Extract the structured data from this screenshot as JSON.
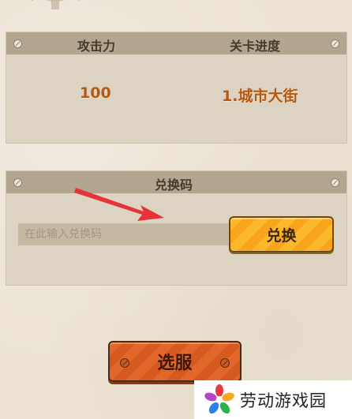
{
  "stats": {
    "attack_label": "攻击力",
    "progress_label": "关卡进度",
    "attack_value": "100",
    "progress_value": "1.城市大街"
  },
  "redeem": {
    "title": "兑换码",
    "placeholder": "在此输入兑换码",
    "button_label": "兑换"
  },
  "server": {
    "button_label": "选服"
  },
  "watermark": {
    "text": "劳动游戏园"
  },
  "colors": {
    "accent_orange": "#b45a16",
    "redeem_button": "#fbb82c",
    "server_button": "#e2672a",
    "arrow": "#e8323a"
  },
  "icons": [
    "gear-icon",
    "pin-icon",
    "arrow-icon",
    "flower-logo-icon"
  ]
}
